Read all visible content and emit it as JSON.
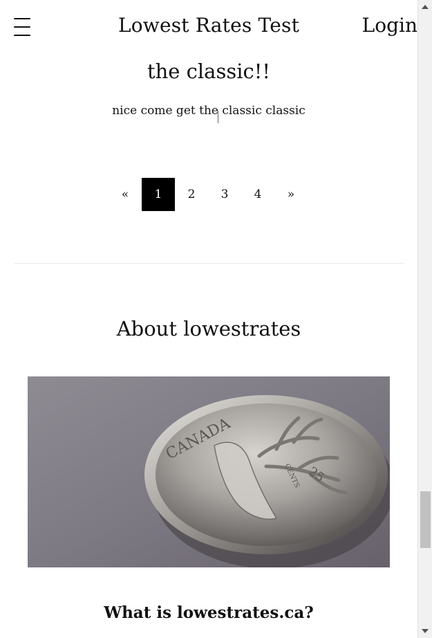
{
  "header": {
    "menu_icon": "hamburger-menu-icon",
    "title": "Lowest Rates Test",
    "login_label": "Login"
  },
  "post": {
    "title": "the classic!!",
    "excerpt": "nice come get the classic classic"
  },
  "pagination": {
    "prev_label": "«",
    "next_label": "»",
    "pages": [
      "1",
      "2",
      "3",
      "4"
    ],
    "current": "1"
  },
  "about": {
    "heading": "About lowestrates",
    "image": {
      "coin_text_top": "CANADA",
      "coin_denomination": "25",
      "coin_unit": "CENTS"
    },
    "faq_heading": "What is lowestrates.ca?"
  },
  "scrollbar": {
    "scroll_position": 0.86
  },
  "colors": {
    "text": "#111111",
    "active_page_bg": "#000000",
    "active_page_text": "#ffffff",
    "divider": "#e7e7e7"
  }
}
